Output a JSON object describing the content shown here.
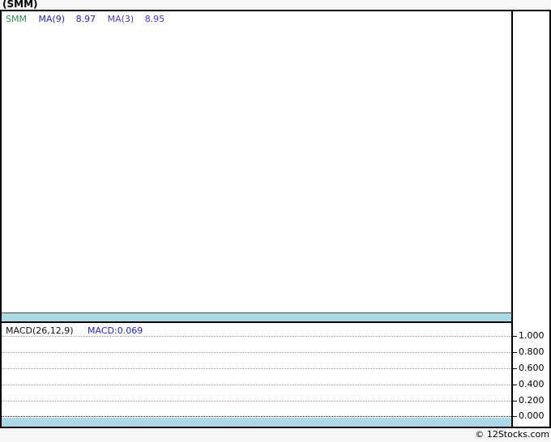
{
  "title": "(SMM)",
  "price_panel": {
    "legend": {
      "symbol": "SMM",
      "ma9_label": "MA(9)",
      "ma9_value": "8.97",
      "ma3_label": "MA(3)",
      "ma3_value": "8.95"
    }
  },
  "macd_panel": {
    "label": "MACD(26,12,9)",
    "value": "MACD:0.069",
    "axis_ticks": [
      "1.000",
      "0.800",
      "0.600",
      "0.400",
      "0.200",
      "0.000"
    ]
  },
  "footer": {
    "copyright": "© 12Stocks.com"
  },
  "colors": {
    "band": "#add8e6",
    "symbol_text": "#2e8b57",
    "ma9_text": "#2222cc",
    "ma3_text": "#4b38d2",
    "border": "#000000"
  },
  "chart_data": [
    {
      "type": "line",
      "title": "SMM price with moving averages",
      "legend": [
        "SMM",
        "MA(9)",
        "MA(3)"
      ],
      "series": [
        {
          "name": "SMM",
          "values": []
        },
        {
          "name": "MA(9)",
          "last_value": 8.97,
          "values": []
        },
        {
          "name": "MA(3)",
          "last_value": 8.95,
          "values": []
        }
      ],
      "grid": false,
      "plot_area_empty": true
    },
    {
      "type": "line",
      "title": "MACD(26,12,9)",
      "series": [
        {
          "name": "MACD",
          "last_value": 0.069,
          "values": []
        }
      ],
      "yticks": [
        1.0,
        0.8,
        0.6,
        0.4,
        0.2,
        0.0
      ],
      "ylim": [
        -0.07,
        1.08
      ],
      "grid": true,
      "grid_style": "dotted horizontal",
      "legend_position": "top-left",
      "axis_position": "right",
      "plot_area_empty": true
    }
  ]
}
